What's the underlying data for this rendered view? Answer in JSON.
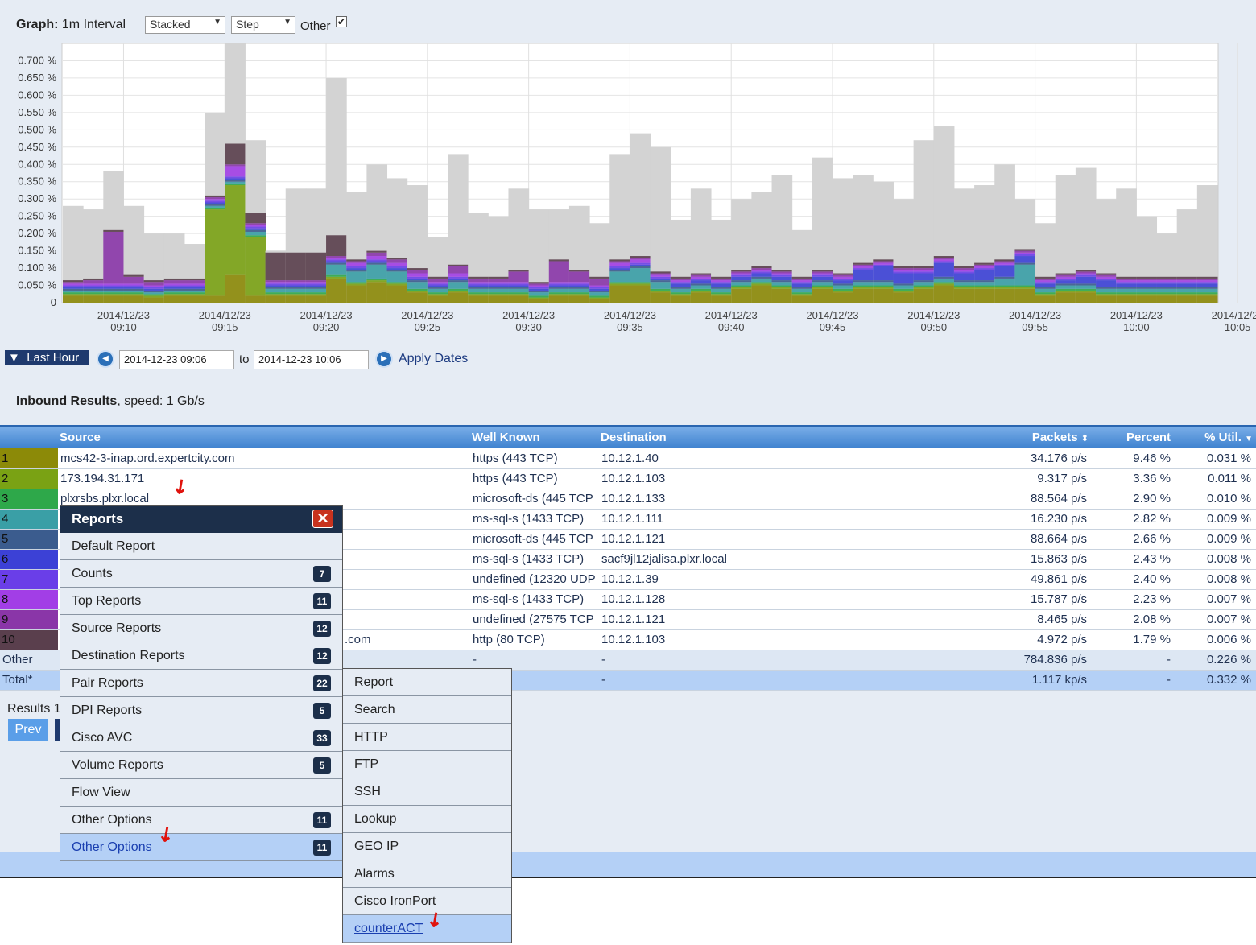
{
  "graph_header": {
    "label": "Graph:",
    "interval": "1m Interval",
    "stack_mode": "Stacked",
    "line_mode": "Step",
    "other_label": "Other",
    "other_checked": true
  },
  "chart_data": {
    "type": "area",
    "stacking": "stacked-step",
    "yunit": "%",
    "ylim": [
      0,
      0.75
    ],
    "y_ticks": [
      "0",
      "0.050 %",
      "0.100 %",
      "0.150 %",
      "0.200 %",
      "0.250 %",
      "0.300 %",
      "0.350 %",
      "0.400 %",
      "0.450 %",
      "0.500 %",
      "0.550 %",
      "0.600 %",
      "0.650 %",
      "0.700 %"
    ],
    "x_ticks": [
      {
        "date": "2014/12/23",
        "time": "09:10"
      },
      {
        "date": "2014/12/23",
        "time": "09:15"
      },
      {
        "date": "2014/12/23",
        "time": "09:20"
      },
      {
        "date": "2014/12/23",
        "time": "09:25"
      },
      {
        "date": "2014/12/23",
        "time": "09:30"
      },
      {
        "date": "2014/12/23",
        "time": "09:35"
      },
      {
        "date": "2014/12/23",
        "time": "09:40"
      },
      {
        "date": "2014/12/23",
        "time": "09:45"
      },
      {
        "date": "2014/12/23",
        "time": "09:50"
      },
      {
        "date": "2014/12/23",
        "time": "09:55"
      },
      {
        "date": "2014/12/23",
        "time": "10:00"
      },
      {
        "date": "2014/12/23",
        "time": "10:05"
      }
    ],
    "x_start": "09:07",
    "x_interval": "1m",
    "other_color": "#d3d3d3",
    "total": [
      0.28,
      0.27,
      0.38,
      0.28,
      0.2,
      0.2,
      0.17,
      0.55,
      0.75,
      0.47,
      0.15,
      0.33,
      0.33,
      0.65,
      0.32,
      0.4,
      0.36,
      0.34,
      0.19,
      0.43,
      0.26,
      0.25,
      0.33,
      0.27,
      0.27,
      0.28,
      0.23,
      0.43,
      0.49,
      0.45,
      0.24,
      0.33,
      0.24,
      0.3,
      0.32,
      0.37,
      0.21,
      0.42,
      0.36,
      0.37,
      0.35,
      0.3,
      0.47,
      0.51,
      0.33,
      0.34,
      0.4,
      0.3,
      0.23,
      0.37,
      0.39,
      0.3,
      0.33,
      0.25,
      0.2,
      0.27,
      0.34
    ],
    "series": [
      {
        "name": "1",
        "color": "#8c8a08",
        "values": [
          0.02,
          0.02,
          0.02,
          0.02,
          0.015,
          0.02,
          0.02,
          0.02,
          0.08,
          0.02,
          0.02,
          0.02,
          0.02,
          0.07,
          0.05,
          0.06,
          0.05,
          0.03,
          0.02,
          0.03,
          0.02,
          0.02,
          0.02,
          0.01,
          0.02,
          0.02,
          0.01,
          0.05,
          0.05,
          0.03,
          0.02,
          0.03,
          0.02,
          0.04,
          0.05,
          0.04,
          0.02,
          0.04,
          0.03,
          0.04,
          0.04,
          0.03,
          0.04,
          0.05,
          0.04,
          0.04,
          0.04,
          0.04,
          0.02,
          0.03,
          0.03,
          0.02,
          0.02,
          0.02,
          0.02,
          0.02,
          0.02
        ]
      },
      {
        "name": "2",
        "color": "#7aa214",
        "values": [
          0.005,
          0.005,
          0.005,
          0.005,
          0.005,
          0.005,
          0.005,
          0.25,
          0.26,
          0.17,
          0.005,
          0.005,
          0.005,
          0.005,
          0.005,
          0.005,
          0.005,
          0.005,
          0.005,
          0.005,
          0.005,
          0.005,
          0.005,
          0.005,
          0.005,
          0.005,
          0.005,
          0.005,
          0.005,
          0.005,
          0.005,
          0.005,
          0.005,
          0.005,
          0.005,
          0.005,
          0.005,
          0.005,
          0.005,
          0.005,
          0.005,
          0.005,
          0.005,
          0.005,
          0.005,
          0.005,
          0.005,
          0.005,
          0.005,
          0.005,
          0.005,
          0.005,
          0.005,
          0.005,
          0.005,
          0.005,
          0.005
        ]
      },
      {
        "name": "3",
        "color": "#2ea84a",
        "values": [
          0.005,
          0.005,
          0.005,
          0.005,
          0.005,
          0.005,
          0.005,
          0.005,
          0.005,
          0.005,
          0.005,
          0.005,
          0.005,
          0.005,
          0.005,
          0.005,
          0.005,
          0.005,
          0.005,
          0.005,
          0.005,
          0.005,
          0.005,
          0.005,
          0.005,
          0.005,
          0.005,
          0.005,
          0.005,
          0.005,
          0.005,
          0.005,
          0.005,
          0.005,
          0.005,
          0.005,
          0.005,
          0.005,
          0.005,
          0.005,
          0.005,
          0.005,
          0.005,
          0.005,
          0.005,
          0.005,
          0.005,
          0.005,
          0.005,
          0.005,
          0.005,
          0.005,
          0.005,
          0.005,
          0.005,
          0.005,
          0.005
        ]
      },
      {
        "name": "4",
        "color": "#3a9fa6",
        "values": [
          0.005,
          0.005,
          0.005,
          0.005,
          0.005,
          0.005,
          0.005,
          0.005,
          0.005,
          0.01,
          0.01,
          0.01,
          0.01,
          0.03,
          0.03,
          0.04,
          0.03,
          0.02,
          0.01,
          0.02,
          0.01,
          0.01,
          0.01,
          0.01,
          0.01,
          0.01,
          0.01,
          0.03,
          0.04,
          0.02,
          0.01,
          0.01,
          0.01,
          0.01,
          0.01,
          0.01,
          0.01,
          0.01,
          0.01,
          0.01,
          0.01,
          0.01,
          0.01,
          0.01,
          0.01,
          0.01,
          0.02,
          0.06,
          0.01,
          0.01,
          0.01,
          0.01,
          0.01,
          0.01,
          0.01,
          0.01,
          0.01
        ]
      },
      {
        "name": "5",
        "color": "#3b5c8e",
        "values": [
          0.005,
          0.005,
          0.005,
          0.005,
          0.005,
          0.005,
          0.005,
          0.005,
          0.005,
          0.005,
          0.005,
          0.005,
          0.005,
          0.005,
          0.005,
          0.005,
          0.005,
          0.005,
          0.005,
          0.005,
          0.005,
          0.005,
          0.005,
          0.005,
          0.005,
          0.005,
          0.005,
          0.005,
          0.005,
          0.005,
          0.005,
          0.005,
          0.005,
          0.005,
          0.005,
          0.005,
          0.005,
          0.005,
          0.005,
          0.005,
          0.005,
          0.005,
          0.005,
          0.005,
          0.005,
          0.005,
          0.005,
          0.005,
          0.005,
          0.005,
          0.005,
          0.005,
          0.005,
          0.005,
          0.005,
          0.005,
          0.005
        ]
      },
      {
        "name": "6",
        "color": "#3c41d6",
        "values": [
          0.005,
          0.005,
          0.005,
          0.005,
          0.005,
          0.005,
          0.005,
          0.005,
          0.005,
          0.005,
          0.005,
          0.005,
          0.005,
          0.005,
          0.005,
          0.005,
          0.005,
          0.005,
          0.005,
          0.005,
          0.005,
          0.005,
          0.005,
          0.005,
          0.005,
          0.005,
          0.005,
          0.005,
          0.005,
          0.005,
          0.01,
          0.01,
          0.01,
          0.01,
          0.01,
          0.01,
          0.01,
          0.01,
          0.01,
          0.03,
          0.04,
          0.03,
          0.02,
          0.04,
          0.02,
          0.03,
          0.03,
          0.02,
          0.01,
          0.01,
          0.02,
          0.02,
          0.01,
          0.01,
          0.01,
          0.01,
          0.01
        ]
      },
      {
        "name": "7",
        "color": "#6a3ee8",
        "values": [
          0.005,
          0.005,
          0.005,
          0.005,
          0.005,
          0.005,
          0.005,
          0.005,
          0.005,
          0.005,
          0.005,
          0.005,
          0.005,
          0.005,
          0.005,
          0.005,
          0.005,
          0.005,
          0.005,
          0.005,
          0.005,
          0.005,
          0.005,
          0.005,
          0.005,
          0.005,
          0.005,
          0.005,
          0.005,
          0.005,
          0.005,
          0.005,
          0.005,
          0.005,
          0.005,
          0.005,
          0.005,
          0.005,
          0.005,
          0.005,
          0.005,
          0.005,
          0.005,
          0.005,
          0.005,
          0.005,
          0.005,
          0.005,
          0.005,
          0.005,
          0.005,
          0.005,
          0.005,
          0.005,
          0.005,
          0.005,
          0.005
        ]
      },
      {
        "name": "8",
        "color": "#a23ee6",
        "values": [
          0.005,
          0.005,
          0.005,
          0.005,
          0.005,
          0.005,
          0.005,
          0.005,
          0.03,
          0.005,
          0.005,
          0.005,
          0.005,
          0.005,
          0.01,
          0.01,
          0.01,
          0.01,
          0.005,
          0.01,
          0.005,
          0.005,
          0.005,
          0.005,
          0.005,
          0.005,
          0.005,
          0.01,
          0.01,
          0.005,
          0.005,
          0.005,
          0.005,
          0.005,
          0.005,
          0.005,
          0.005,
          0.005,
          0.005,
          0.005,
          0.005,
          0.005,
          0.005,
          0.005,
          0.005,
          0.005,
          0.005,
          0.005,
          0.005,
          0.005,
          0.005,
          0.005,
          0.005,
          0.005,
          0.005,
          0.005,
          0.005
        ]
      },
      {
        "name": "9",
        "color": "#8a36a8",
        "values": [
          0.005,
          0.01,
          0.15,
          0.02,
          0.01,
          0.01,
          0.01,
          0.005,
          0.005,
          0.005,
          0.005,
          0.005,
          0.005,
          0.005,
          0.005,
          0.01,
          0.01,
          0.01,
          0.01,
          0.02,
          0.01,
          0.01,
          0.03,
          0.005,
          0.06,
          0.03,
          0.02,
          0.005,
          0.005,
          0.005,
          0.005,
          0.005,
          0.005,
          0.005,
          0.005,
          0.005,
          0.005,
          0.005,
          0.005,
          0.005,
          0.005,
          0.005,
          0.005,
          0.005,
          0.005,
          0.005,
          0.005,
          0.005,
          0.005,
          0.005,
          0.005,
          0.005,
          0.005,
          0.005,
          0.005,
          0.005,
          0.005
        ]
      },
      {
        "name": "10",
        "color": "#5a3f4d",
        "values": [
          0.005,
          0.005,
          0.005,
          0.005,
          0.005,
          0.005,
          0.005,
          0.005,
          0.06,
          0.03,
          0.08,
          0.08,
          0.08,
          0.06,
          0.005,
          0.005,
          0.005,
          0.005,
          0.005,
          0.005,
          0.005,
          0.005,
          0.005,
          0.005,
          0.005,
          0.005,
          0.005,
          0.005,
          0.005,
          0.005,
          0.005,
          0.005,
          0.005,
          0.005,
          0.005,
          0.005,
          0.005,
          0.005,
          0.005,
          0.005,
          0.005,
          0.005,
          0.005,
          0.005,
          0.005,
          0.005,
          0.005,
          0.005,
          0.005,
          0.005,
          0.005,
          0.005,
          0.005,
          0.005,
          0.005,
          0.005,
          0.005
        ]
      }
    ]
  },
  "date_range": {
    "preset": "Last Hour",
    "from": "2014-12-23 09:06",
    "to_label": "to",
    "to": "2014-12-23 10:06",
    "apply": "Apply Dates"
  },
  "results": {
    "title": "Inbound Results",
    "speed_text": ", speed: 1 Gb/s"
  },
  "table": {
    "headers": {
      "source": "Source",
      "well_known": "Well Known",
      "destination": "Destination",
      "packets": "Packets",
      "percent": "Percent",
      "util": "% Util."
    },
    "rows": [
      {
        "idx": "1",
        "color": "#8c8a08",
        "source": "mcs42-3-inap.ord.expertcity.com",
        "well_known": "https (443 TCP)",
        "destination": "10.12.1.40",
        "packets": "34.176 p/s",
        "percent": "9.46 %",
        "util": "0.031 %"
      },
      {
        "idx": "2",
        "color": "#7aa214",
        "source": "173.194.31.171",
        "well_known": "https (443 TCP)",
        "destination": "10.12.1.103",
        "packets": "9.317 p/s",
        "percent": "3.36 %",
        "util": "0.011 %"
      },
      {
        "idx": "3",
        "color": "#2ea84a",
        "source": "plxrsbs.plxr.local",
        "well_known": "microsoft-ds (445 TCP",
        "destination": "10.12.1.133",
        "packets": "88.564 p/s",
        "percent": "2.90 %",
        "util": "0.010 %"
      },
      {
        "idx": "4",
        "color": "#3a9fa6",
        "source": "",
        "well_known": "ms-sql-s (1433 TCP)",
        "destination": "10.12.1.111",
        "packets": "16.230 p/s",
        "percent": "2.82 %",
        "util": "0.009 %"
      },
      {
        "idx": "5",
        "color": "#3b5c8e",
        "source": "",
        "well_known": "microsoft-ds (445 TCP",
        "destination": "10.12.1.121",
        "packets": "88.664 p/s",
        "percent": "2.66 %",
        "util": "0.009 %"
      },
      {
        "idx": "6",
        "color": "#3c41d6",
        "source": "",
        "well_known": "ms-sql-s (1433 TCP)",
        "destination": "sacf9jl12jalisa.plxr.local",
        "packets": "15.863 p/s",
        "percent": "2.43 %",
        "util": "0.008 %"
      },
      {
        "idx": "7",
        "color": "#6a3ee8",
        "source": "",
        "well_known": "undefined (12320 UDP",
        "destination": "10.12.1.39",
        "packets": "49.861 p/s",
        "percent": "2.40 %",
        "util": "0.008 %"
      },
      {
        "idx": "8",
        "color": "#a23ee6",
        "source": "",
        "well_known": "ms-sql-s (1433 TCP)",
        "destination": "10.12.1.128",
        "packets": "15.787 p/s",
        "percent": "2.23 %",
        "util": "0.007 %"
      },
      {
        "idx": "9",
        "color": "#8a36a8",
        "source": "",
        "well_known": "undefined (27575 TCP",
        "destination": "10.12.1.121",
        "packets": "8.465 p/s",
        "percent": "2.08 %",
        "util": "0.007 %"
      },
      {
        "idx": "10",
        "color": "#5a3f4d",
        "source": ".com",
        "well_known": "http (80 TCP)",
        "destination": "10.12.1.103",
        "packets": "4.972 p/s",
        "percent": "1.79 %",
        "util": "0.006 %"
      }
    ],
    "other": {
      "label": "Other",
      "well_known": "-",
      "destination": "-",
      "packets": "784.836 p/s",
      "percent": "-",
      "util": "0.226 %"
    },
    "total": {
      "label": "Total*",
      "well_known": "-",
      "destination": "-",
      "packets": "1.117 kp/s",
      "percent": "-",
      "util": "0.332 %"
    }
  },
  "pager": {
    "results_text": "Results 1",
    "prev": "Prev"
  },
  "reports_menu": {
    "title": "Reports",
    "items": [
      {
        "label": "Default Report",
        "count": ""
      },
      {
        "label": "Counts",
        "count": "7"
      },
      {
        "label": "Top Reports",
        "count": "11"
      },
      {
        "label": "Source Reports",
        "count": "12"
      },
      {
        "label": "Destination Reports",
        "count": "12"
      },
      {
        "label": "Pair Reports",
        "count": "22"
      },
      {
        "label": "DPI Reports",
        "count": "5"
      },
      {
        "label": "Cisco AVC",
        "count": "33"
      },
      {
        "label": "Volume Reports",
        "count": "5"
      },
      {
        "label": "Flow View",
        "count": ""
      },
      {
        "label": "Other Options",
        "count": "11"
      },
      {
        "label": "Other Options",
        "count": "11",
        "active": true
      }
    ]
  },
  "submenu": {
    "items": [
      "Report",
      "Search",
      "HTTP",
      "FTP",
      "SSH",
      "Lookup",
      "GEO IP",
      "Alarms",
      "Cisco IronPort",
      "counterACT"
    ],
    "active_index": 9
  }
}
